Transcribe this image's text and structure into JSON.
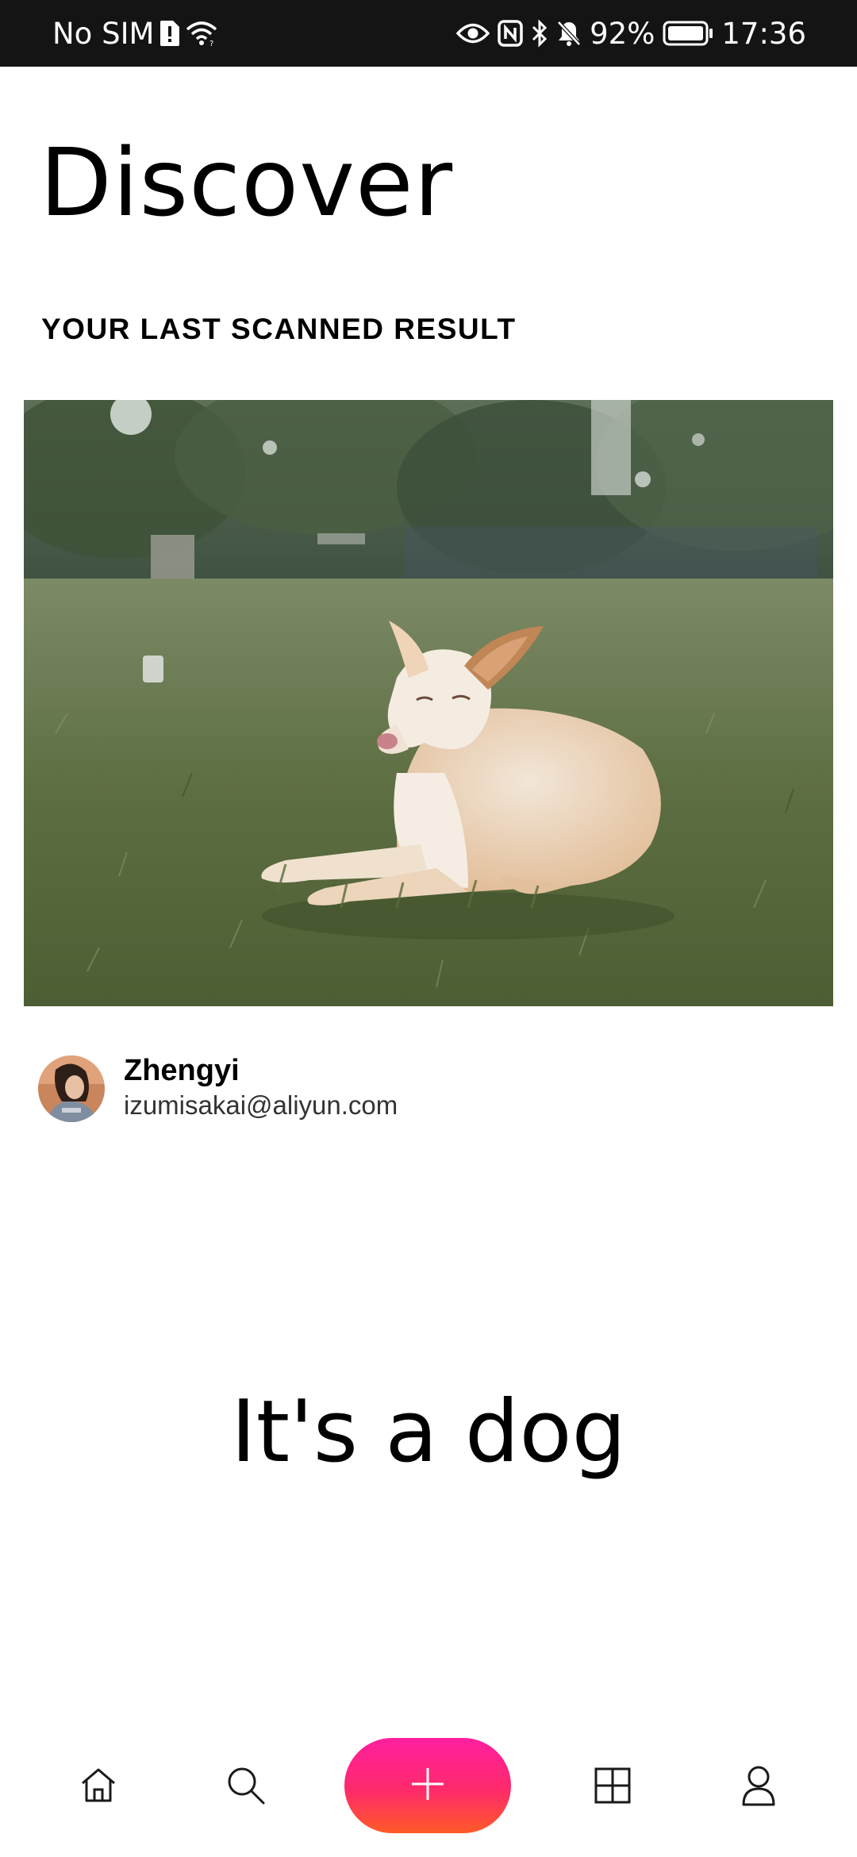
{
  "status_bar": {
    "carrier": "No SIM",
    "battery": "92%",
    "time": "17:36",
    "icons": [
      "sim-alert-icon",
      "wifi-icon",
      "eye-icon",
      "nfc-icon",
      "bluetooth-icon",
      "bell-off-icon",
      "battery-icon"
    ]
  },
  "header": {
    "title": "Discover"
  },
  "last_scan": {
    "heading": "YOUR LAST SCANNED RESULT",
    "image_subject": "dog-lying-on-grass-photo"
  },
  "user": {
    "name": "Zhengyi",
    "email": "izumisakai@aliyun.com"
  },
  "result": {
    "text": "It's a dog"
  },
  "bottom_nav": {
    "items": [
      {
        "icon": "home-icon"
      },
      {
        "icon": "search-icon"
      },
      {
        "icon": "plus-icon"
      },
      {
        "icon": "grid-icon"
      },
      {
        "icon": "user-icon"
      }
    ],
    "add_button_gradient": [
      "#ff1fa0",
      "#ff5a28"
    ]
  },
  "colors": {
    "status_bar_bg": "#141414",
    "text_primary": "#000000",
    "text_secondary": "#333333"
  }
}
